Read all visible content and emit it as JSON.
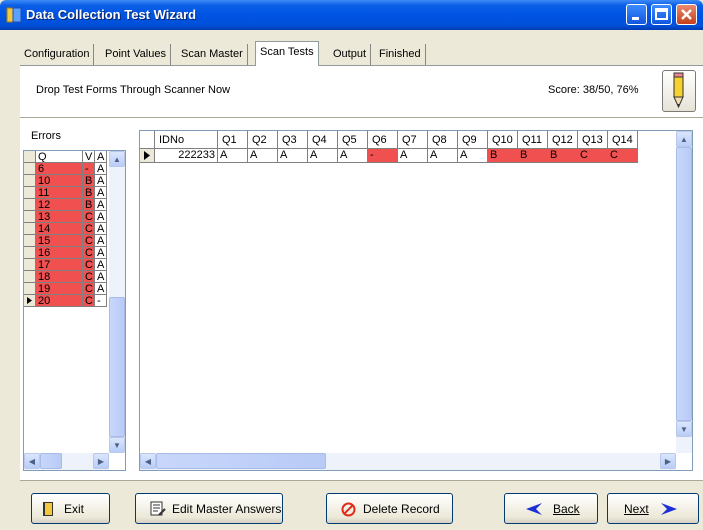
{
  "window": {
    "title": "Data Collection Test Wizard"
  },
  "tabs": [
    {
      "label": "Configuration"
    },
    {
      "label": "Point Values"
    },
    {
      "label": "Scan Master"
    },
    {
      "label": "Scan Tests"
    },
    {
      "label": "Output"
    },
    {
      "label": "Finished"
    }
  ],
  "header": {
    "instruction": "Drop Test Forms Through Scanner Now",
    "score": "Score: 38/50, 76%"
  },
  "errors": {
    "label": "Errors",
    "columns": [
      "Q",
      "V",
      "A"
    ],
    "rows": [
      [
        "6",
        "-",
        "A"
      ],
      [
        "10",
        "B",
        "A"
      ],
      [
        "11",
        "B",
        "A"
      ],
      [
        "12",
        "B",
        "A"
      ],
      [
        "13",
        "C",
        "A"
      ],
      [
        "14",
        "C",
        "A"
      ],
      [
        "15",
        "C",
        "A"
      ],
      [
        "16",
        "C",
        "A"
      ],
      [
        "17",
        "C",
        "A"
      ],
      [
        "18",
        "C",
        "A"
      ],
      [
        "19",
        "C",
        "A"
      ],
      [
        "20",
        "C",
        "-"
      ]
    ]
  },
  "grid": {
    "columns": [
      "IDNo",
      "Q1",
      "Q2",
      "Q3",
      "Q4",
      "Q5",
      "Q6",
      "Q7",
      "Q8",
      "Q9",
      "Q10",
      "Q11",
      "Q12",
      "Q13",
      "Q14"
    ],
    "row": [
      "222233",
      "A",
      "A",
      "A",
      "A",
      "A",
      "-",
      "A",
      "A",
      "A",
      "B",
      "B",
      "B",
      "C",
      "C"
    ],
    "wrong": [
      false,
      false,
      false,
      false,
      false,
      false,
      true,
      false,
      false,
      false,
      true,
      true,
      true,
      true,
      true
    ]
  },
  "buttons": {
    "exit": "Exit",
    "edit_master": "Edit Master Answers",
    "delete": "Delete Record",
    "back": "Back",
    "next": "Next"
  },
  "colors": {
    "wrong_answer": "#f05050",
    "title_bar": "#0054e3"
  }
}
